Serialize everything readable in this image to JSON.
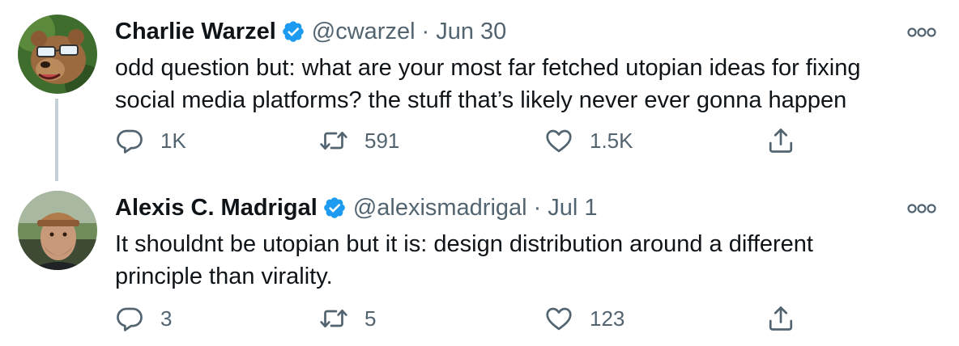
{
  "tweets": [
    {
      "author_name": "Charlie Warzel",
      "handle": "@cwarzel",
      "separator": "·",
      "date": "Jun 30",
      "text_lines": [
        "odd question but: what are your most far fetched utopian ideas for fixing",
        "social media platforms? the stuff that’s likely never ever gonna happen"
      ],
      "replies": "1K",
      "retweets": "591",
      "likes": "1.5K"
    },
    {
      "author_name": "Alexis C. Madrigal",
      "handle": "@alexismadrigal",
      "separator": "·",
      "date": "Jul 1",
      "text_lines": [
        "It shouldnt be utopian but it is: design distribution around a different",
        "principle than virality."
      ],
      "replies": "3",
      "retweets": "5",
      "likes": "123"
    }
  ],
  "colors": {
    "text": "#0f1419",
    "secondary": "#536471",
    "verified": "#1d9bf0",
    "thread_line": "#c4cfd6"
  },
  "icons": [
    "verified-badge-icon",
    "more-icon",
    "reply-icon",
    "retweet-icon",
    "like-icon",
    "share-icon"
  ]
}
